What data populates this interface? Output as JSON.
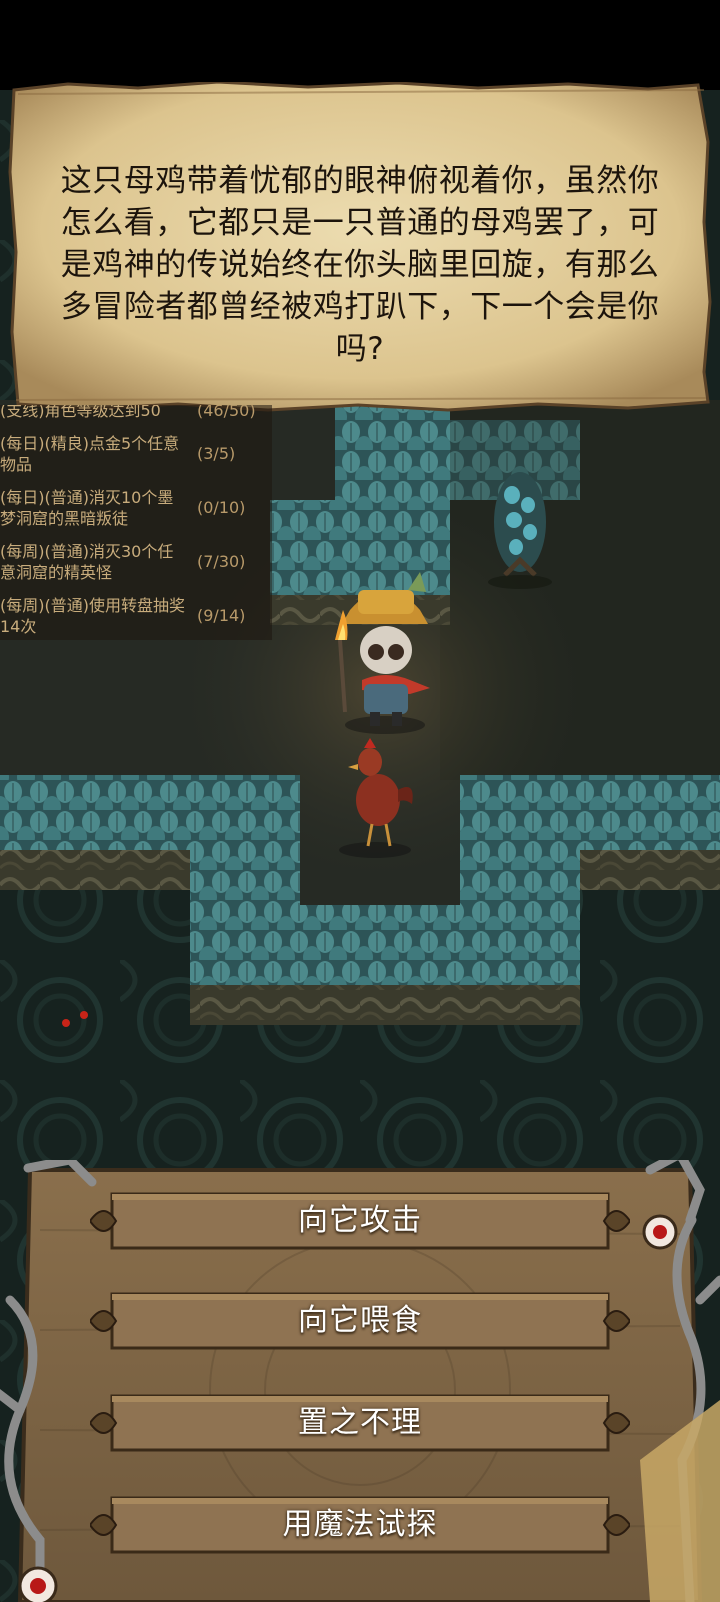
{
  "event": {
    "story_text": "这只母鸡带着忧郁的眼神俯视着你，虽然你怎么看，它都只是一只普通的母鸡罢了，可是鸡神的传说始终在你头脑里回旋，有那么多冒险者都曾经被鸡打趴下，下一个会是你吗?"
  },
  "quests": [
    {
      "name": "(支线)角色等级达到50",
      "progress": "(46/50)"
    },
    {
      "name": "(每日)(精良)点金5个任意物品",
      "progress": "(3/5)"
    },
    {
      "name": "(每日)(普通)消灭10个墨梦洞窟的黑暗叛徒",
      "progress": "(0/10)"
    },
    {
      "name": "(每周)(普通)消灭30个任意洞窟的精英怪",
      "progress": "(7/30)"
    },
    {
      "name": "(每周)(普通)使用转盘抽奖14次",
      "progress": "(9/14)"
    }
  ],
  "choices": [
    {
      "label": "向它攻击"
    },
    {
      "label": "向它喂食"
    },
    {
      "label": "置之不理"
    },
    {
      "label": "用魔法试探"
    }
  ],
  "colors": {
    "parchment": "#e6d2a4",
    "floor": "#2a2e26",
    "abyss": "#1a2724",
    "foliage": "#3f7378",
    "board_wood": "#7a6244",
    "button_wood": "#8f7352"
  }
}
